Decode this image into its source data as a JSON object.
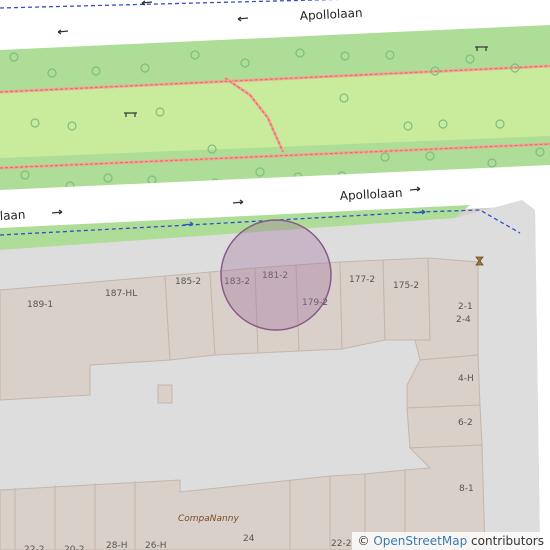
{
  "map": {
    "streets": [
      "Apollolaan",
      "Apollolaan",
      "laan"
    ],
    "house_numbers": [
      "189-1",
      "187-HL",
      "185-2",
      "183-2",
      "181-2",
      "179-2",
      "177-2",
      "175-2",
      "2-1",
      "2-4",
      "4-H",
      "6-2",
      "8-1",
      "22-2",
      "20-2",
      "28-H",
      "26-H",
      "24",
      "22-2"
    ],
    "poi": "CompaNanny",
    "marker": {
      "label": "181-2",
      "color": "#a0709a"
    }
  },
  "attribution": {
    "symbol": "©",
    "link_text": "OpenStreetMap",
    "suffix": " contributors"
  }
}
